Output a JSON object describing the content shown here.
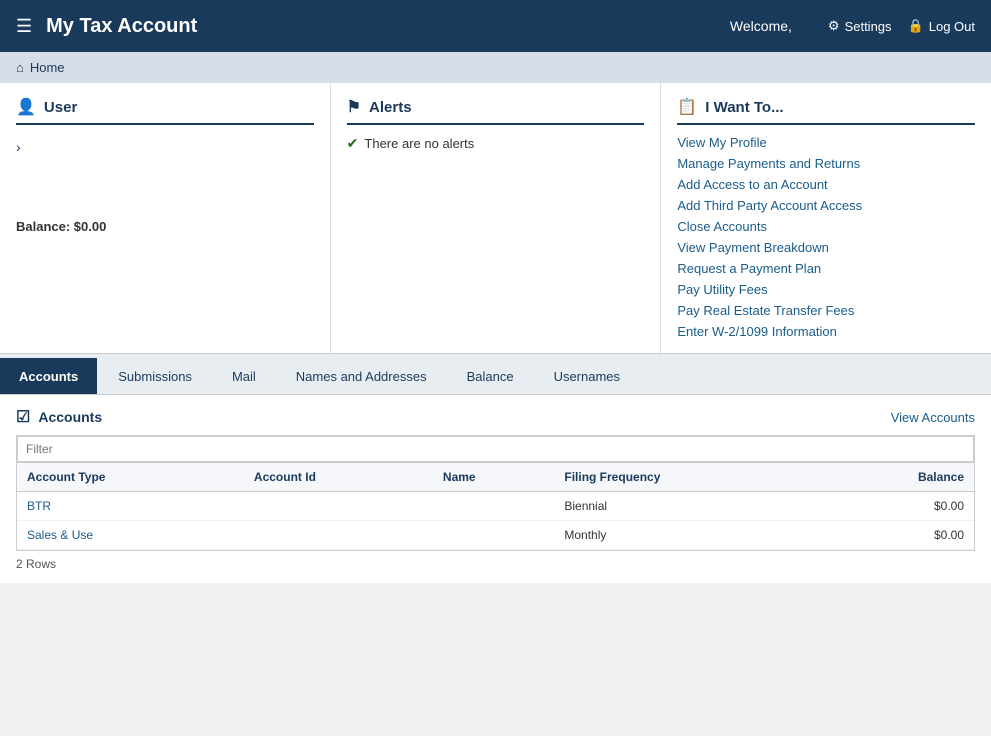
{
  "header": {
    "menu_icon": "☰",
    "title": "My Tax Account",
    "welcome": "Welcome,",
    "settings_label": "Settings",
    "logout_label": "Log Out",
    "settings_icon": "⚙",
    "logout_icon": "🔒"
  },
  "breadcrumb": {
    "home_label": "Home",
    "home_icon": "⌂"
  },
  "user_panel": {
    "title": "User",
    "icon": "👤",
    "chevron": "›",
    "balance": "Balance: $0.00"
  },
  "alerts_panel": {
    "title": "Alerts",
    "icon": "⚑",
    "no_alerts": "There are no alerts",
    "check_icon": "✔"
  },
  "want_to_panel": {
    "title": "I Want To...",
    "icon": "📋",
    "links": [
      "View My Profile",
      "Manage Payments and Returns",
      "Add Access to an Account",
      "Add Third Party Account Access",
      "Close Accounts",
      "View Payment Breakdown",
      "Request a Payment Plan",
      "Pay Utility Fees",
      "Pay Real Estate Transfer Fees",
      "Enter W-2/1099 Information"
    ]
  },
  "tabs": [
    {
      "label": "Accounts",
      "active": true
    },
    {
      "label": "Submissions",
      "active": false
    },
    {
      "label": "Mail",
      "active": false
    },
    {
      "label": "Names and Addresses",
      "active": false
    },
    {
      "label": "Balance",
      "active": false
    },
    {
      "label": "Usernames",
      "active": false
    }
  ],
  "accounts_section": {
    "title": "Accounts",
    "checkbox_icon": "☑",
    "view_accounts_label": "View Accounts",
    "filter_placeholder": "Filter",
    "table": {
      "columns": [
        "Account Type",
        "Account Id",
        "Name",
        "Filing Frequency",
        "Balance"
      ],
      "rows": [
        {
          "account_type": "BTR",
          "account_id": "",
          "name": "",
          "filing_frequency": "Biennial",
          "balance": "$0.00"
        },
        {
          "account_type": "Sales & Use",
          "account_id": "",
          "name": "",
          "filing_frequency": "Monthly",
          "balance": "$0.00"
        }
      ]
    },
    "rows_count": "2 Rows"
  }
}
